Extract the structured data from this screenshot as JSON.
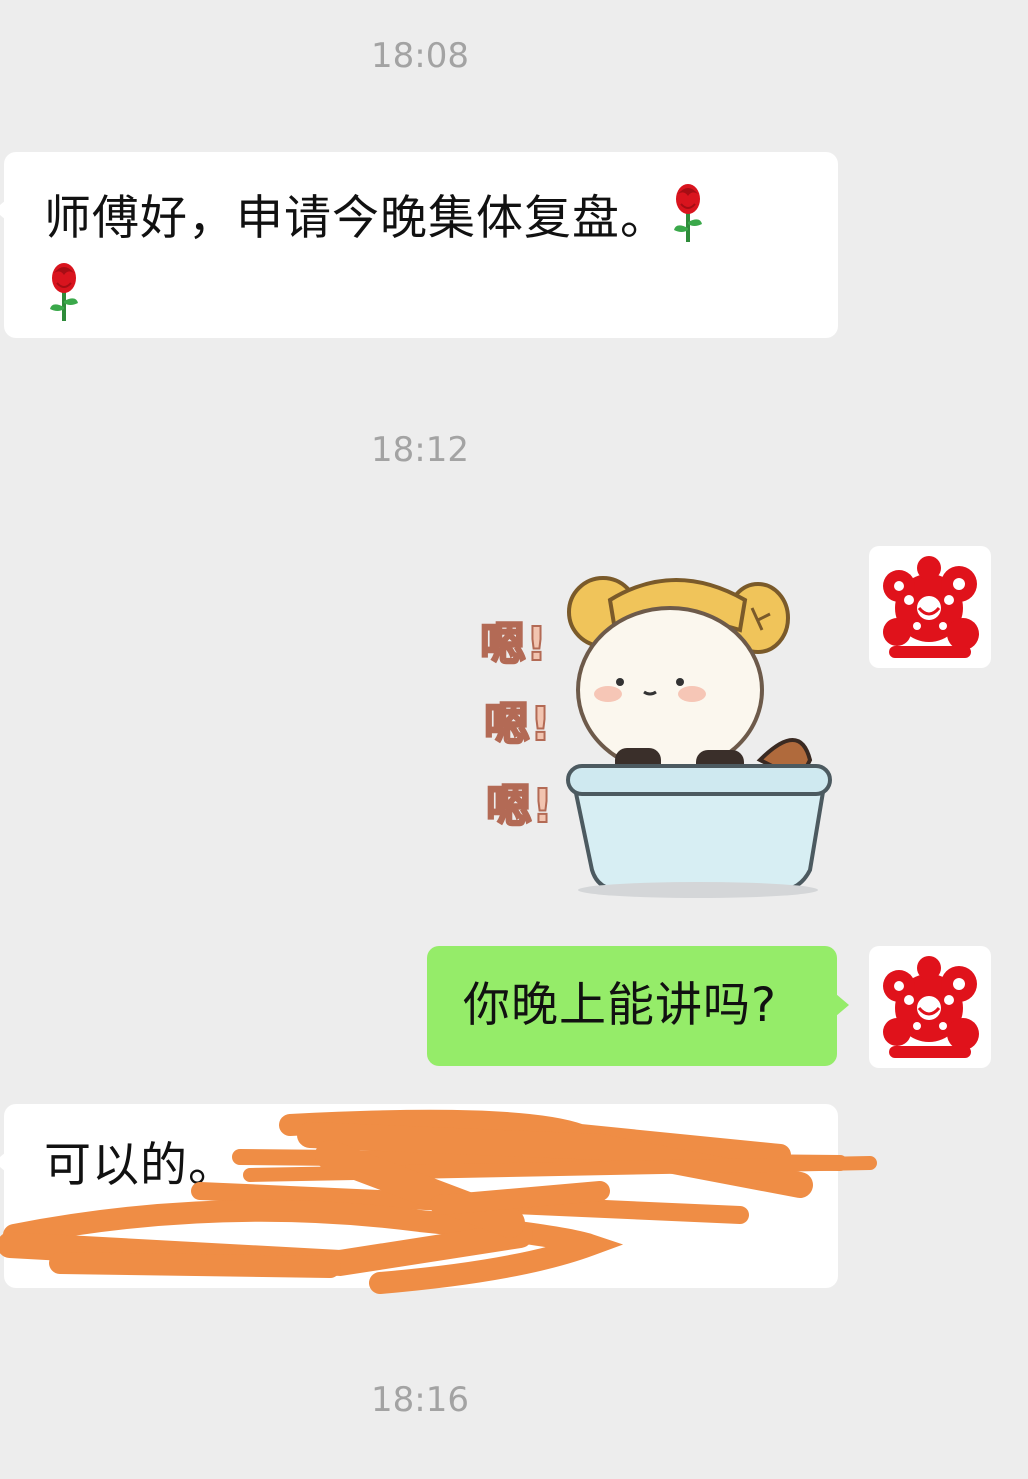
{
  "timestamps": [
    "18:08",
    "18:12",
    "18:16"
  ],
  "messages": [
    {
      "side": "left",
      "text": "师傅好，申请今晚集体复盘。",
      "emoji": "rose"
    },
    {
      "side": "right",
      "type": "sticker",
      "sticker_text": [
        "嗯!",
        "嗯!",
        "嗯!"
      ]
    },
    {
      "side": "right",
      "text": "你晚上能讲吗?"
    },
    {
      "side": "left",
      "text": "可以的。",
      "redacted": true
    }
  ],
  "colors": {
    "background": "#ededed",
    "bubble_incoming": "#ffffff",
    "bubble_outgoing": "#95ec69",
    "timestamp": "#a3a3a3",
    "redaction": "#ef8d45",
    "avatar_papercut": "#e0121b"
  },
  "icons": {
    "rose": "rose-emoji",
    "avatar": "papercut-avatar"
  }
}
